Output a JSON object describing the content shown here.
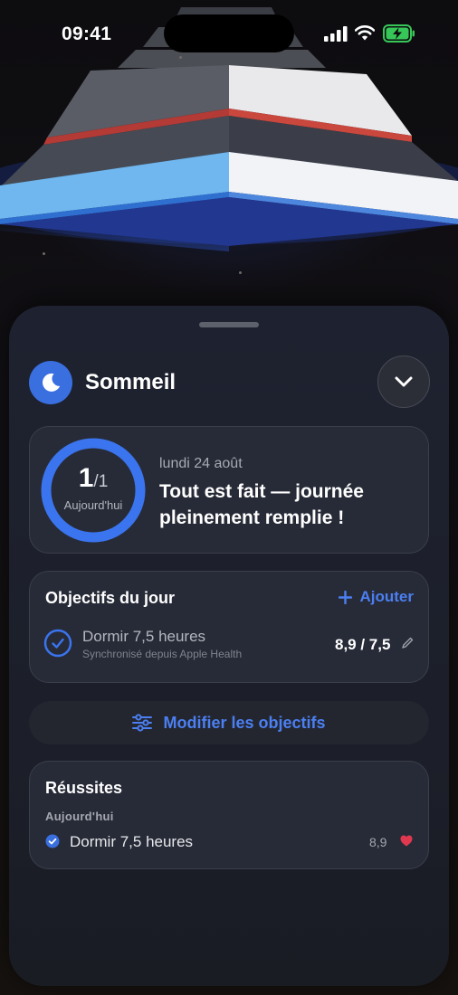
{
  "status_bar": {
    "time": "09:41"
  },
  "header": {
    "title": "Sommeil",
    "icon": "moon-icon",
    "collapse_icon": "chevron-down-icon"
  },
  "progress": {
    "completed": "1",
    "total": "1",
    "caption": "Aujourd'hui",
    "fraction": 1.0,
    "date": "lundi 24 août",
    "headline": "Tout est fait — journée pleinement remplie !"
  },
  "goals": {
    "title": "Objectifs du jour",
    "add_label": "Ajouter",
    "items": [
      {
        "name": "Dormir 7,5 heures",
        "subtitle": "Synchronisé depuis Apple Health",
        "value": "8,9 / 7,5",
        "completed": true
      }
    ]
  },
  "edit_goals": {
    "label": "Modifier les objectifs",
    "icon": "sliders-icon"
  },
  "achievements": {
    "title": "Réussites",
    "section": "Aujourd'hui",
    "items": [
      {
        "name": "Dormir 7,5 heures",
        "value": "8,9",
        "icon": "heart-icon"
      }
    ]
  },
  "colors": {
    "accent": "#3a6fe0",
    "link": "#4b7ff2",
    "heart": "#e0384e",
    "sheet": "#1e2230",
    "card": "#272b37"
  }
}
